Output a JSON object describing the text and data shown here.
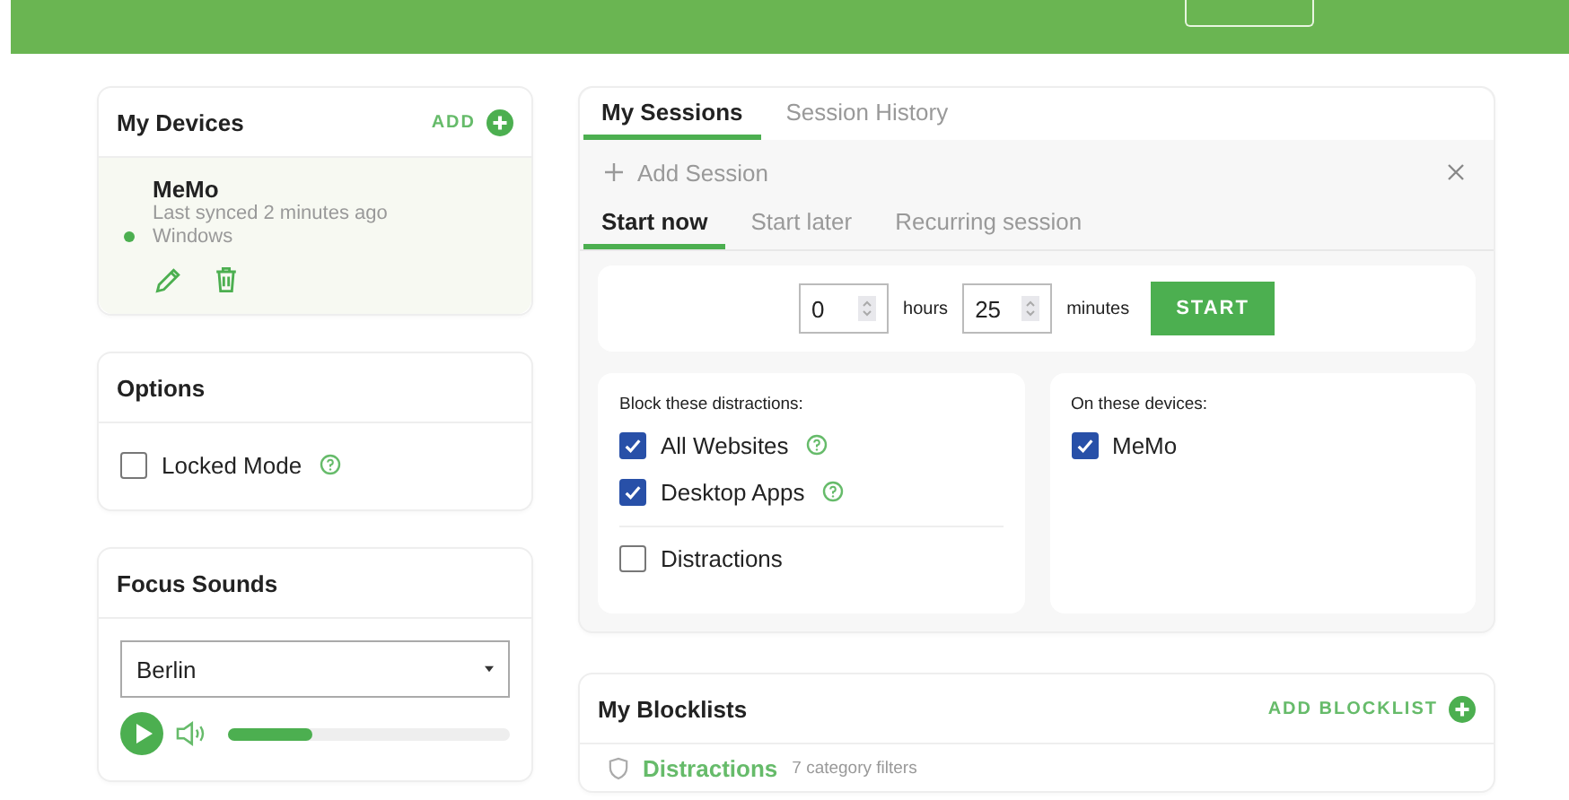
{
  "devices": {
    "title": "My Devices",
    "add_label": "ADD",
    "items": [
      {
        "name": "MeMo",
        "synced": "Last synced 2 minutes ago",
        "os": "Windows",
        "online": true
      }
    ]
  },
  "options": {
    "title": "Options",
    "items": [
      {
        "label": "Locked Mode",
        "checked": false,
        "help": true
      }
    ]
  },
  "focus_sounds": {
    "title": "Focus Sounds",
    "sound": "Berlin",
    "volume": {
      "level": 0.3
    }
  },
  "sessions": {
    "tabs": [
      {
        "label": "My Sessions",
        "selected": true
      },
      {
        "label": "Session History",
        "selected": false
      }
    ],
    "add_session": "Add Session",
    "mode_tabs": [
      {
        "label": "Start now",
        "selected": true
      },
      {
        "label": "Start later",
        "selected": false
      },
      {
        "label": "Recurring session",
        "selected": false
      }
    ],
    "hours": "0",
    "hours_label": "hours",
    "minutes": "25",
    "minutes_label": "minutes",
    "start": "START",
    "block": {
      "title": "Block these distractions:",
      "items": [
        {
          "label": "All Websites",
          "checked": true,
          "help": true
        },
        {
          "label": "Desktop Apps",
          "checked": true,
          "help": true
        }
      ],
      "lists": [
        {
          "label": "Distractions",
          "checked": false
        }
      ]
    },
    "targets": {
      "title": "On these devices:",
      "items": [
        {
          "label": "MeMo",
          "checked": true
        }
      ]
    }
  },
  "blocklists": {
    "title": "My Blocklists",
    "add_label": "ADD BLOCKLIST",
    "items": [
      {
        "name": "Distractions",
        "detail": "7 category filters"
      }
    ]
  }
}
